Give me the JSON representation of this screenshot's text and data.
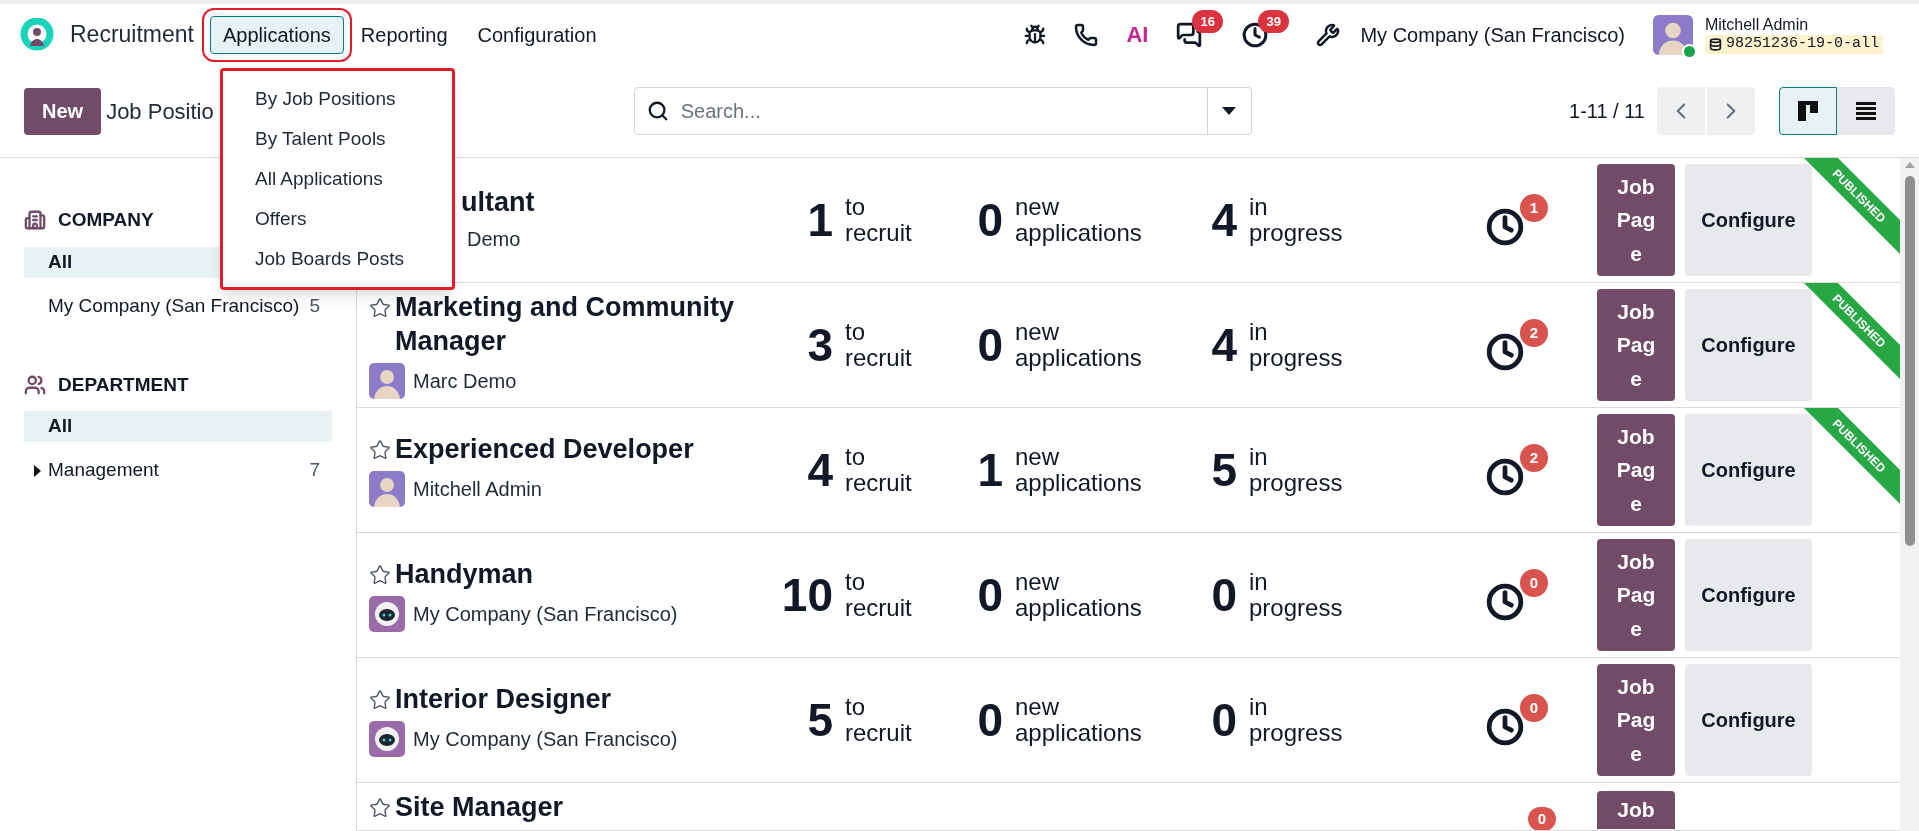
{
  "app": {
    "name": "Recruitment"
  },
  "menu": [
    {
      "label": "Applications",
      "selected": true
    },
    {
      "label": "Reporting",
      "selected": false
    },
    {
      "label": "Configuration",
      "selected": false
    }
  ],
  "dropdown": [
    "By Job Positions",
    "By Talent Pools",
    "All Applications",
    "Offers",
    "Job Boards Posts"
  ],
  "systray": {
    "ai_label": "AI",
    "messages_count": "16",
    "activities_count": "39",
    "company": "My Company (San Francisco)",
    "user_name": "Mitchell Admin",
    "user_online": true,
    "database": "98251236-19-0-all"
  },
  "control": {
    "new_button": "New",
    "title": "Job Positio",
    "search_placeholder": "Search...",
    "pager": "1-11 / 11",
    "views": [
      {
        "kind": "kanban",
        "selected": true
      },
      {
        "kind": "list",
        "selected": false
      }
    ]
  },
  "sidebar": [
    {
      "kind": "company",
      "title": "COMPANY",
      "items": [
        {
          "label": "All",
          "selected": true
        },
        {
          "label": "My Company (San Francisco)",
          "count": "5",
          "selected": false
        }
      ]
    },
    {
      "kind": "department",
      "title": "DEPARTMENT",
      "items": [
        {
          "label": "All",
          "selected": true
        },
        {
          "label": "Management",
          "count": "7",
          "selected": false,
          "expanded": false
        }
      ]
    }
  ],
  "jobs": [
    {
      "title": "ultant",
      "owner": "Demo",
      "to_recruit": "1",
      "to_recruit_label": "to recruit",
      "new_applications": "0",
      "new_label": "new applications",
      "in_progress": "4",
      "progress_label": "in progress",
      "activities": "1",
      "job_page": "Job Page",
      "configure": "Configure",
      "published": true,
      "ribbon": "PUBLISHED"
    },
    {
      "title": "Marketing and Community Manager",
      "starred": false,
      "kind": "person",
      "owner": "Marc Demo",
      "to_recruit": "3",
      "to_recruit_label": "to recruit",
      "new_applications": "0",
      "new_label": "new applications",
      "in_progress": "4",
      "progress_label": "in progress",
      "activities": "2",
      "job_page": "Job Page",
      "configure": "Configure",
      "published": true,
      "ribbon": "PUBLISHED"
    },
    {
      "title": "Experienced Developer",
      "starred": false,
      "kind": "person",
      "owner": "Mitchell Admin",
      "to_recruit": "4",
      "to_recruit_label": "to recruit",
      "new_applications": "1",
      "new_label": "new applications",
      "in_progress": "5",
      "progress_label": "in progress",
      "activities": "2",
      "job_page": "Job Page",
      "configure": "Configure",
      "published": true,
      "ribbon": "PUBLISHED"
    },
    {
      "title": "Handyman",
      "starred": false,
      "kind": "company",
      "owner": "My Company (San Francisco)",
      "to_recruit": "10",
      "to_recruit_label": "to recruit",
      "new_applications": "0",
      "new_label": "new applications",
      "in_progress": "0",
      "progress_label": "in progress",
      "activities": "0",
      "job_page": "Job Page",
      "configure": "Configure",
      "published": false
    },
    {
      "title": "Interior Designer",
      "starred": false,
      "kind": "company",
      "owner": "My Company (San Francisco)",
      "to_recruit": "5",
      "to_recruit_label": "to recruit",
      "new_applications": "0",
      "new_label": "new applications",
      "in_progress": "0",
      "progress_label": "in progress",
      "activities": "0",
      "job_page": "Job Page",
      "configure": "Configure",
      "published": false
    },
    {
      "title": "Site Manager",
      "starred": false,
      "activities": "0",
      "job_page": "Job",
      "published": false
    }
  ]
}
